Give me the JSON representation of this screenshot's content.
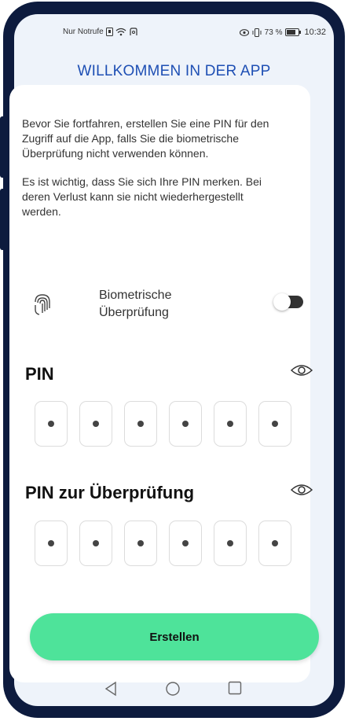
{
  "status_bar": {
    "carrier": "Nur Notrufe",
    "battery_percent": "73 %",
    "time": "10:32"
  },
  "header": {
    "title": "WILLKOMMEN IN DER APP"
  },
  "intro": {
    "paragraph1": "Bevor Sie fortfahren, erstellen Sie eine PIN für den Zugriff auf die App, falls Sie die biometrische Überprüfung nicht verwenden können.",
    "paragraph2": "Es ist wichtig, dass Sie sich Ihre PIN merken. Bei deren Verlust kann sie nicht wiederhergestellt werden."
  },
  "biometric": {
    "label_line1": "Biometrische",
    "label_line2": "Überprüfung",
    "enabled": false
  },
  "pin": {
    "label": "PIN",
    "digits": 6
  },
  "pin_confirm": {
    "label": "PIN zur Überprüfung",
    "digits": 6
  },
  "actions": {
    "create_label": "Erstellen"
  },
  "colors": {
    "title": "#1e4fb4",
    "button": "#4ee39a",
    "frame": "#0d1b3e"
  },
  "icons": [
    "fingerprint-icon",
    "eye-icon",
    "back-nav-icon",
    "home-nav-icon",
    "recents-nav-icon"
  ]
}
